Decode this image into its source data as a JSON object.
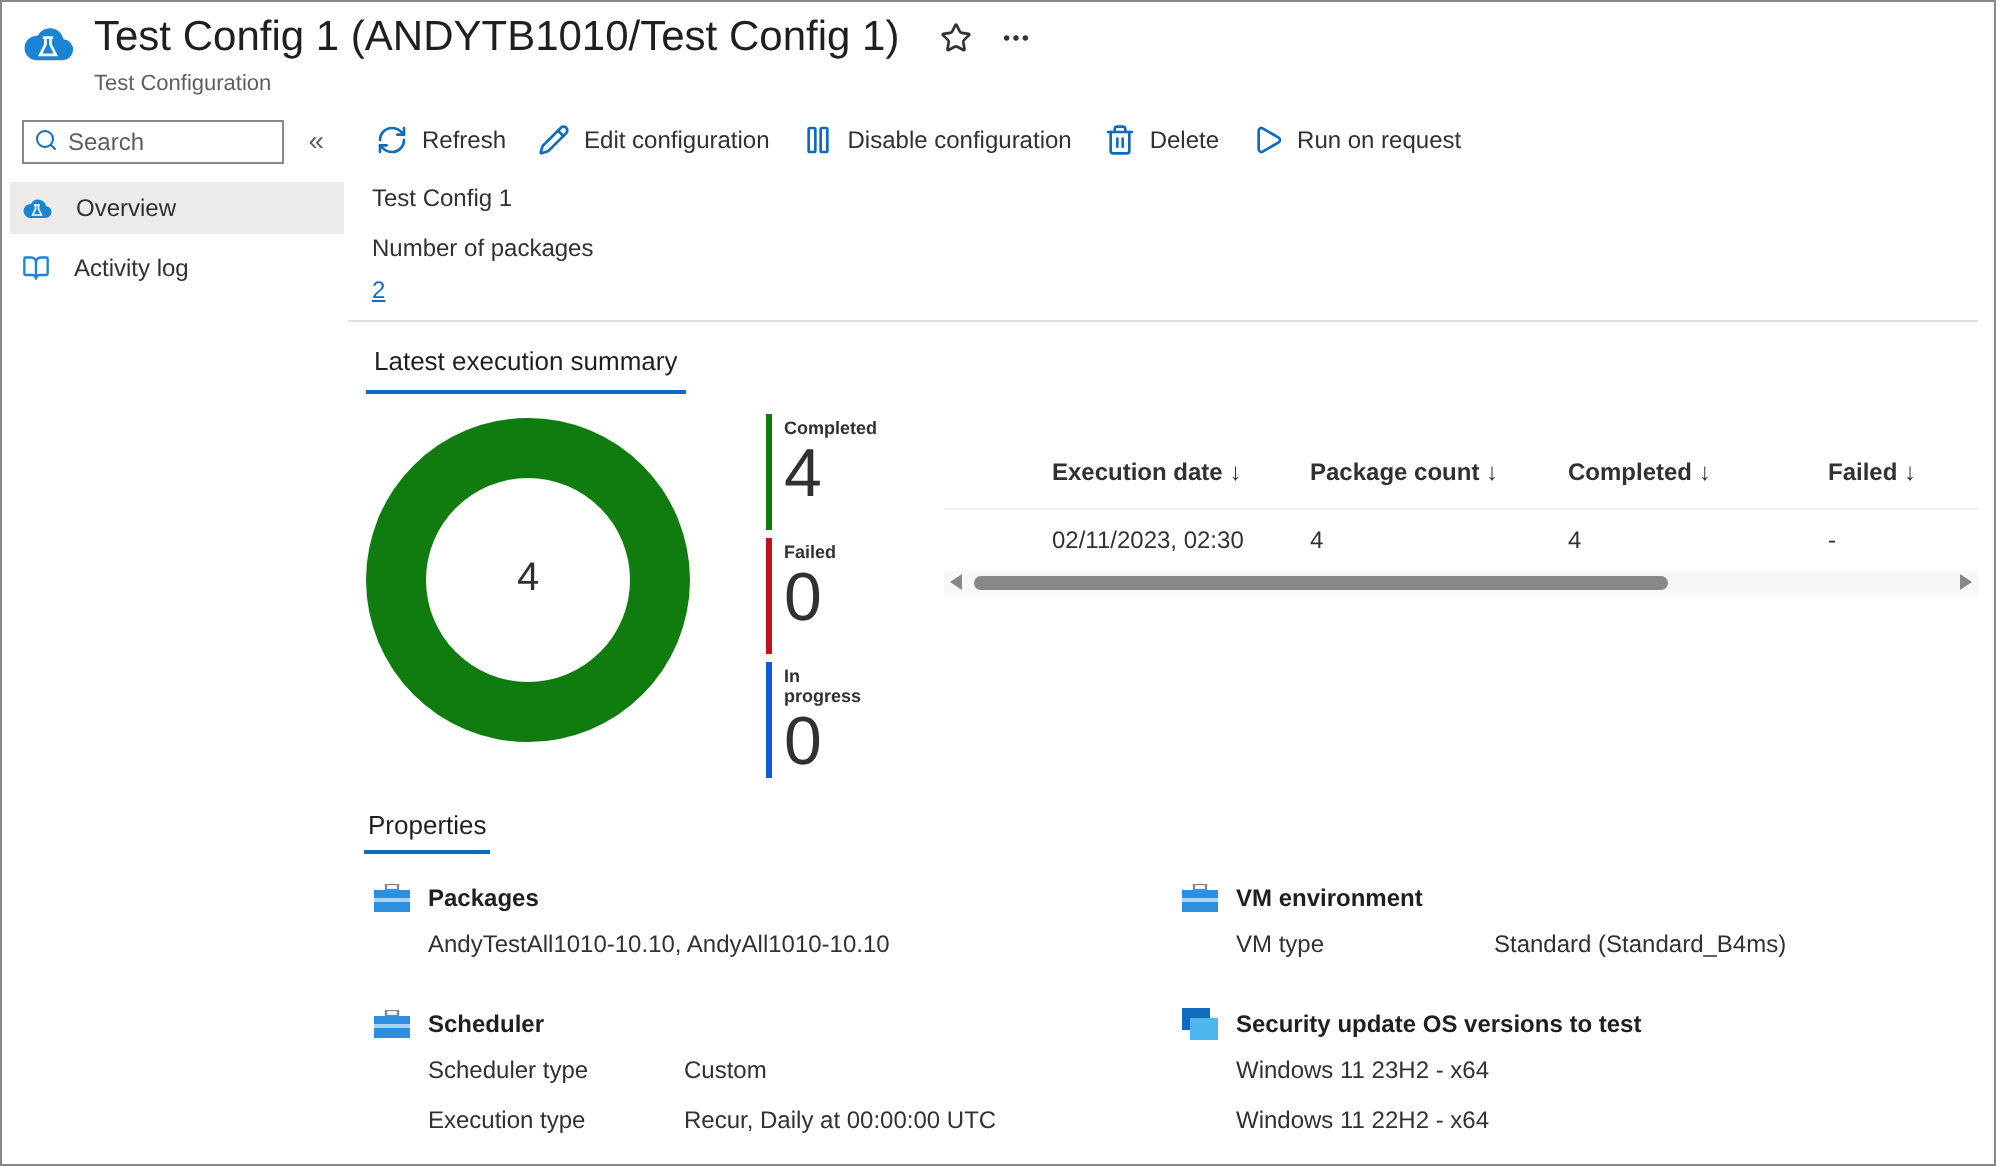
{
  "header": {
    "title": "Test Config 1 (ANDYTB1010/Test Config 1)",
    "subtitle": "Test Configuration",
    "favorite": false
  },
  "sidebar": {
    "search": {
      "placeholder": "Search"
    },
    "collapse": "«",
    "items": [
      {
        "label": "Overview",
        "kind": "overview",
        "selected": true
      },
      {
        "label": "Activity log",
        "kind": "log",
        "selected": false
      }
    ]
  },
  "toolbar": [
    {
      "label": "Refresh",
      "kind": "refresh"
    },
    {
      "label": "Edit configuration",
      "kind": "edit"
    },
    {
      "label": "Disable configuration",
      "kind": "pause"
    },
    {
      "label": "Delete",
      "kind": "delete"
    },
    {
      "label": "Run on request",
      "kind": "run"
    }
  ],
  "essentials": [
    {
      "value": "Test Config 1",
      "kind": "text"
    },
    {
      "label": "Number of packages",
      "value": "2",
      "kind": "link"
    }
  ],
  "summary": {
    "tab": {
      "label": "Latest execution summary",
      "selected": true
    },
    "ring": {
      "kind": "donut"
    },
    "center_label": "4",
    "legend": [
      {
        "label": "Completed",
        "count": "4",
        "color": "#107c10"
      },
      {
        "label": "Failed",
        "count": "0",
        "color": "#c50f1f"
      },
      {
        "label": "In progress",
        "count": "0",
        "color": "#0f5ad8"
      }
    ],
    "table": {
      "columns": [
        "Execution date ↓",
        "Package count ↓",
        "Completed ↓",
        "Failed ↓"
      ],
      "rows": [
        [
          "02/11/2023, 02:30",
          "4",
          "4",
          "-"
        ]
      ]
    }
  },
  "properties": {
    "tab": {
      "label": "Properties",
      "selected": true
    },
    "sections": [
      {
        "title": "Packages",
        "kind": "toolbox",
        "lines": [
          "AndyTestAll1010-10.10, AndyAll1010-10.10"
        ]
      },
      {
        "title": "VM environment",
        "kind": "toolbox",
        "rows": [
          {
            "label": "VM type",
            "value": "Standard (Standard_B4ms)"
          }
        ]
      },
      {
        "title": "Scheduler",
        "kind": "toolbox",
        "rows": [
          {
            "label": "Scheduler type",
            "value": "Custom"
          },
          {
            "label": "Execution type",
            "value": "Recur, Daily at 00:00:00 UTC"
          }
        ]
      },
      {
        "title": "Security update OS versions to test",
        "kind": "windows",
        "lines": [
          "Windows 11 23H2 - x64",
          "Windows 11 22H2 - x64"
        ]
      }
    ]
  }
}
